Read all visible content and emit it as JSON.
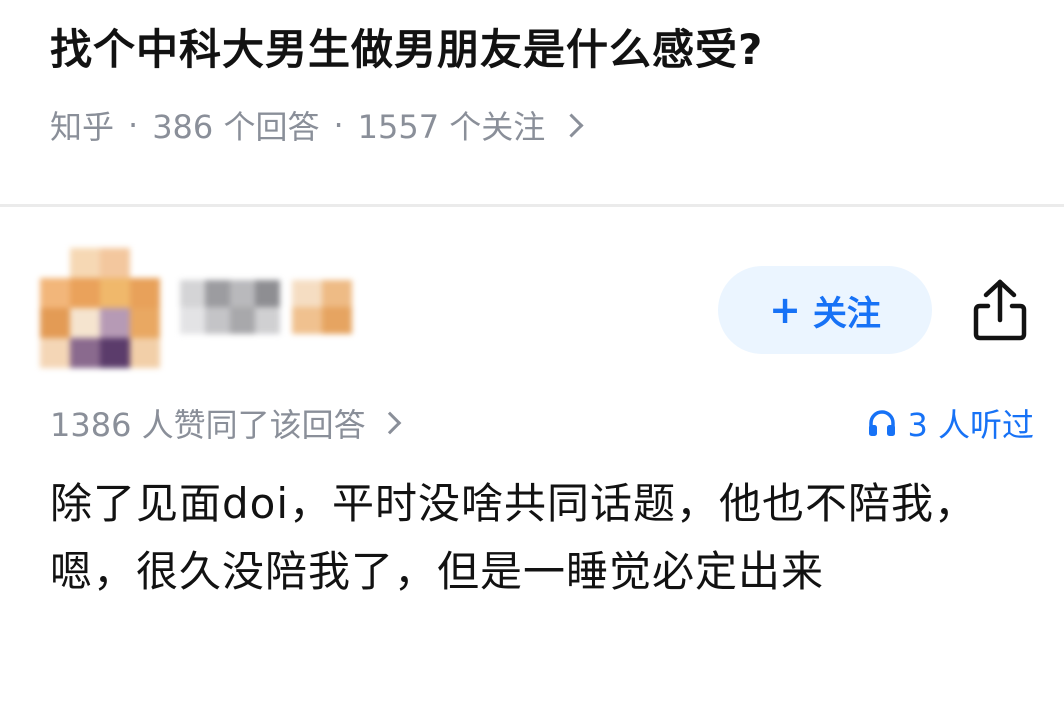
{
  "question": {
    "title": "找个中科大男生做男朋友是什么感受?",
    "source": "知乎",
    "answers_count": "386 个回答",
    "followers_count": "1557 个关注"
  },
  "author": {
    "avatar_icon": "avatar-pixelated",
    "follow_label": "关注",
    "follow_icon": "plus-icon",
    "share_icon": "share-icon"
  },
  "answer": {
    "votes_text": "1386 人赞同了该回答",
    "listeners_text": "3 人听过",
    "listen_icon": "headphones-icon",
    "content": "除了见面doi，平时没啥共同话题，他也不陪我，嗯，很久没陪我了，但是一睡觉必定出来"
  },
  "colors": {
    "accent": "#1772f6",
    "follow_bg": "#ebf5ff",
    "meta_gray": "#8a8f99",
    "text": "#121212"
  }
}
